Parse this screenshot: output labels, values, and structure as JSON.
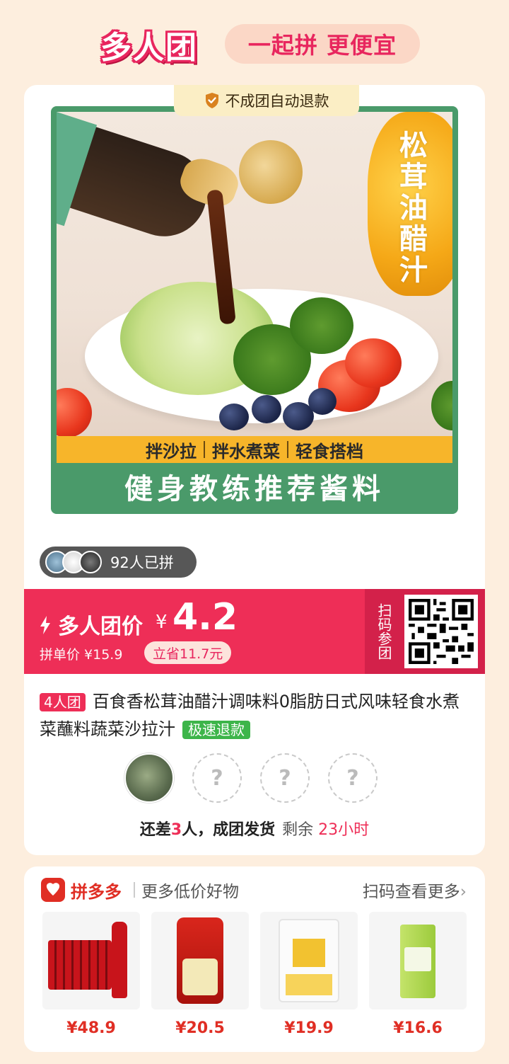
{
  "header": {
    "logo_text": "多人团",
    "slogan": "一起拼 更便宜"
  },
  "card": {
    "refund_tag": "不成团自动退款",
    "image_text": {
      "pepper_label": "松茸油醋汁",
      "tags": [
        "拌沙拉",
        "拌水煮菜",
        "轻食搭档"
      ],
      "slogan": "健身教练推荐酱料"
    },
    "joined": "92人已拼",
    "price": {
      "label": "多人团价",
      "currency": "¥",
      "value": "4.2",
      "single_price": "拼单价 ¥15.9",
      "save": "立省11.7元"
    },
    "scan": {
      "label": "扫码参团"
    },
    "title": {
      "group_chip": "4人团",
      "text": "百食香松茸油醋汁调味料0脂肪日式风味轻食水煮菜蘸料蔬菜沙拉汁",
      "fast_chip": "极速退款"
    },
    "members": {
      "placeholder": "?"
    },
    "status": {
      "prefix": "还差",
      "count": "3",
      "suffix": "人，成团发货",
      "remain_label": "剩余",
      "remain_time": "23小时"
    }
  },
  "more": {
    "brand": "拼多多",
    "subtitle": "更多低价好物",
    "scan_more": "扫码查看更多",
    "chevron": "›",
    "products": [
      {
        "price": "¥48.9",
        "image": "cola-bottles"
      },
      {
        "price": "¥20.5",
        "image": "rice-bag"
      },
      {
        "price": "¥19.9",
        "image": "flour-bag"
      },
      {
        "price": "¥16.6",
        "image": "tissue-pack"
      }
    ]
  },
  "colors": {
    "accent": "#ee2e57",
    "page_bg": "#fdeede",
    "pdd_red": "#e02e24",
    "green": "#3db54a"
  }
}
